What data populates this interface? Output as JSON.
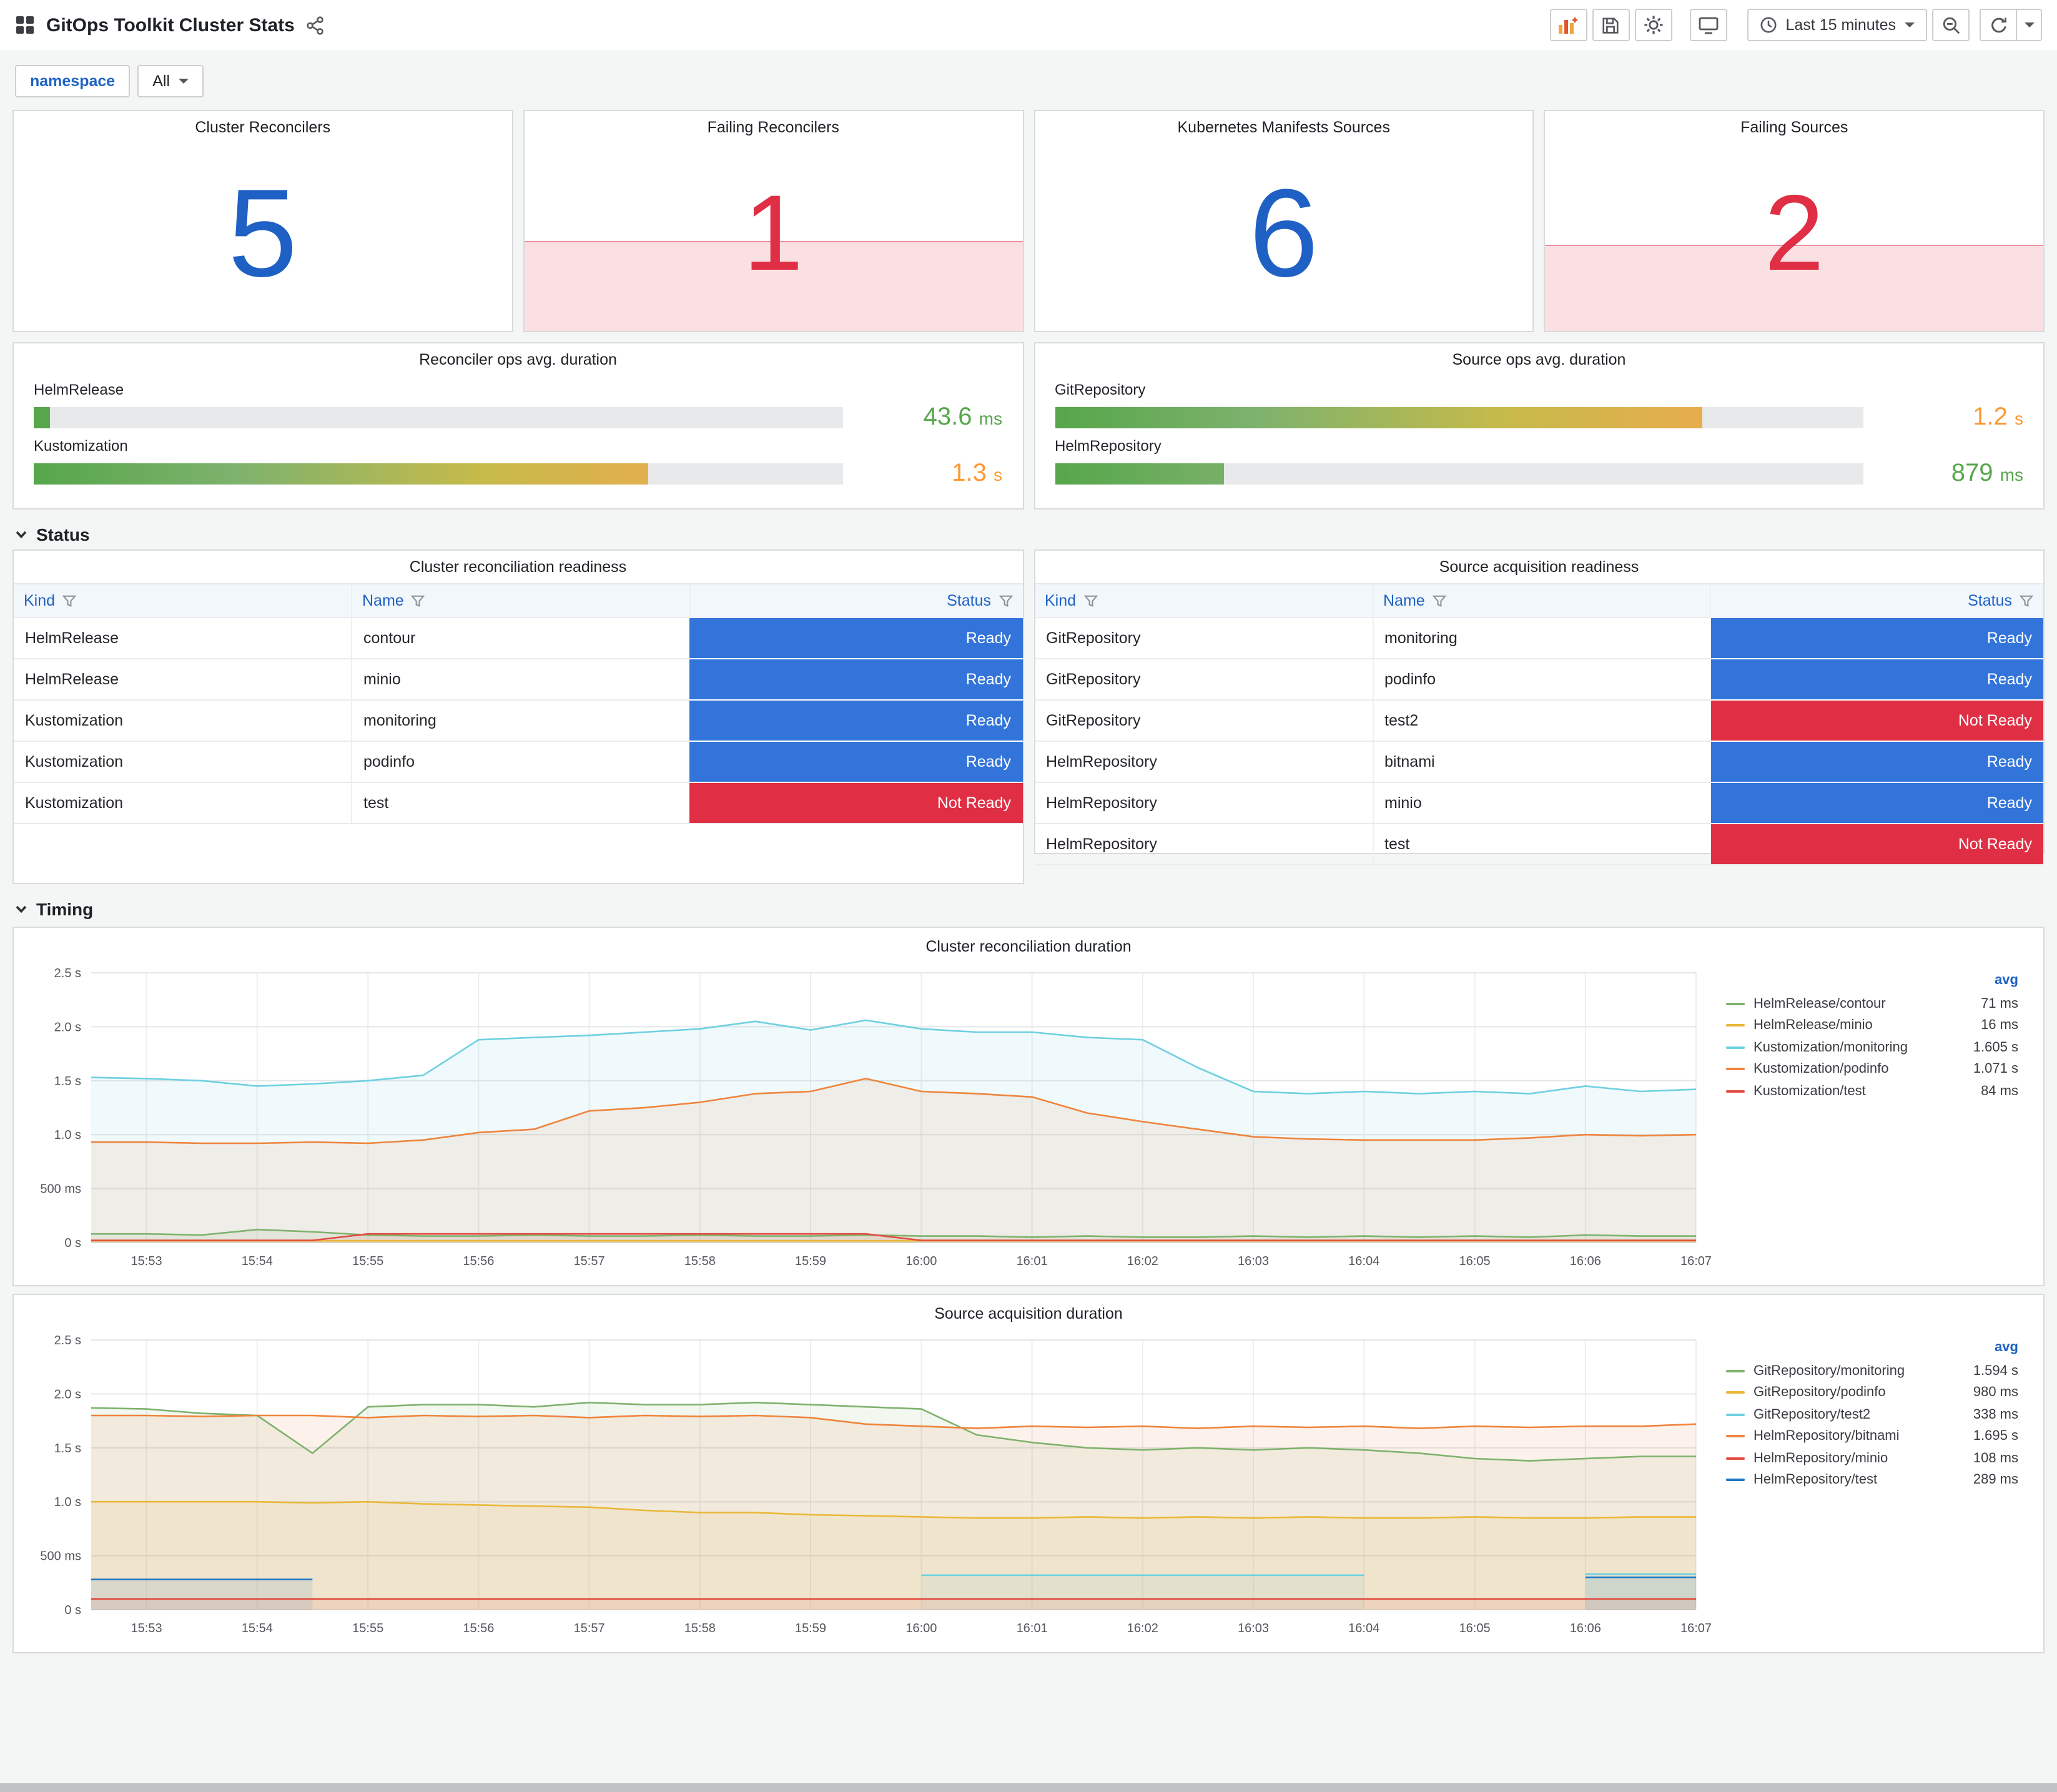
{
  "header": {
    "title": "GitOps Toolkit Cluster Stats",
    "time_picker": "Last 15 minutes"
  },
  "variables": {
    "namespace_label": "namespace",
    "namespace_value": "All"
  },
  "stats": [
    {
      "title": "Cluster Reconcilers",
      "value": "5",
      "state": "ok"
    },
    {
      "title": "Failing Reconcilers",
      "value": "1",
      "state": "alert"
    },
    {
      "title": "Kubernetes Manifests Sources",
      "value": "6",
      "state": "ok"
    },
    {
      "title": "Failing Sources",
      "value": "2",
      "state": "alert"
    }
  ],
  "colors": {
    "stat_ok": "#1f60c4",
    "stat_alert": "#e02f44",
    "ready_bg": "#3274d9",
    "not_ready_bg": "#e02f44"
  },
  "gauges": [
    {
      "title": "Reconciler ops avg. duration",
      "rows": [
        {
          "label": "HelmRelease",
          "value": "43.6",
          "unit": "ms",
          "pct": 2,
          "value_color": "#56a64b"
        },
        {
          "label": "Kustomization",
          "value": "1.3",
          "unit": "s",
          "pct": 76,
          "value_color": "#ff9830"
        }
      ]
    },
    {
      "title": "Source ops avg. duration",
      "rows": [
        {
          "label": "GitRepository",
          "value": "1.2",
          "unit": "s",
          "pct": 80,
          "value_color": "#ff9830"
        },
        {
          "label": "HelmRepository",
          "value": "879",
          "unit": "ms",
          "pct": 21,
          "value_color": "#56a64b"
        }
      ]
    }
  ],
  "sections": {
    "status": "Status",
    "timing": "Timing"
  },
  "tables": [
    {
      "title": "Cluster reconciliation readiness",
      "columns": [
        "Kind",
        "Name",
        "Status"
      ],
      "rows": [
        [
          "HelmRelease",
          "contour",
          "Ready"
        ],
        [
          "HelmRelease",
          "minio",
          "Ready"
        ],
        [
          "Kustomization",
          "monitoring",
          "Ready"
        ],
        [
          "Kustomization",
          "podinfo",
          "Ready"
        ],
        [
          "Kustomization",
          "test",
          "Not Ready"
        ]
      ]
    },
    {
      "title": "Source acquisition readiness",
      "columns": [
        "Kind",
        "Name",
        "Status"
      ],
      "rows": [
        [
          "GitRepository",
          "monitoring",
          "Ready"
        ],
        [
          "GitRepository",
          "podinfo",
          "Ready"
        ],
        [
          "GitRepository",
          "test2",
          "Not Ready"
        ],
        [
          "HelmRepository",
          "bitnami",
          "Ready"
        ],
        [
          "HelmRepository",
          "minio",
          "Ready"
        ],
        [
          "HelmRepository",
          "test",
          "Not Ready"
        ]
      ]
    }
  ],
  "chart_data": [
    {
      "type": "line",
      "title": "Cluster reconciliation duration",
      "legend_header": "avg",
      "ylim": [
        0,
        2.5
      ],
      "y_ticks": [
        {
          "v": 0,
          "label": "0 s"
        },
        {
          "v": 0.5,
          "label": "500 ms"
        },
        {
          "v": 1.0,
          "label": "1.0 s"
        },
        {
          "v": 1.5,
          "label": "1.5 s"
        },
        {
          "v": 2.0,
          "label": "2.0 s"
        },
        {
          "v": 2.5,
          "label": "2.5 s"
        }
      ],
      "x_ticks": [
        "15:53",
        "15:54",
        "15:55",
        "15:56",
        "15:57",
        "15:58",
        "15:59",
        "16:00",
        "16:01",
        "16:02",
        "16:03",
        "16:04",
        "16:05",
        "16:06",
        "16:07"
      ],
      "series": [
        {
          "name": "HelmRelease/contour",
          "avg": "71 ms",
          "color": "#7EB26D",
          "values": [
            0.08,
            0.08,
            0.07,
            0.12,
            0.1,
            0.07,
            0.06,
            0.06,
            0.07,
            0.06,
            0.06,
            0.07,
            0.06,
            0.06,
            0.07,
            0.06,
            0.06,
            0.05,
            0.06,
            0.05,
            0.05,
            0.06,
            0.05,
            0.06,
            0.05,
            0.06,
            0.05,
            0.07,
            0.06,
            0.06
          ]
        },
        {
          "name": "HelmRelease/minio",
          "avg": "16 ms",
          "color": "#EAB839",
          "values": [
            0.016,
            0.016,
            0.016,
            0.016,
            0.016,
            0.016,
            0.016,
            0.016,
            0.016,
            0.016,
            0.016,
            0.016,
            0.016,
            0.016,
            0.016,
            0.016,
            0.016,
            0.016,
            0.016,
            0.016,
            0.016,
            0.016,
            0.016,
            0.016,
            0.016,
            0.016,
            0.016,
            0.016,
            0.016,
            0.016
          ]
        },
        {
          "name": "Kustomization/monitoring",
          "avg": "1.605 s",
          "color": "#6ED0E0",
          "values": [
            1.53,
            1.52,
            1.5,
            1.45,
            1.47,
            1.5,
            1.55,
            1.88,
            1.9,
            1.92,
            1.95,
            1.98,
            2.05,
            1.97,
            2.06,
            1.98,
            1.95,
            1.95,
            1.9,
            1.88,
            1.62,
            1.4,
            1.38,
            1.4,
            1.38,
            1.4,
            1.38,
            1.45,
            1.4,
            1.42
          ]
        },
        {
          "name": "Kustomization/podinfo",
          "avg": "1.071 s",
          "color": "#EF843C",
          "values": [
            0.93,
            0.93,
            0.92,
            0.92,
            0.93,
            0.92,
            0.95,
            1.02,
            1.05,
            1.22,
            1.25,
            1.3,
            1.38,
            1.4,
            1.52,
            1.4,
            1.38,
            1.35,
            1.2,
            1.12,
            1.05,
            0.98,
            0.96,
            0.95,
            0.95,
            0.95,
            0.97,
            1.0,
            0.99,
            1.0
          ]
        },
        {
          "name": "Kustomization/test",
          "avg": "84 ms",
          "color": "#E24D42",
          "values": [
            0.02,
            0.02,
            0.02,
            0.02,
            0.02,
            0.08,
            0.08,
            0.08,
            0.08,
            0.08,
            0.08,
            0.08,
            0.08,
            0.08,
            0.08,
            0.02,
            0.02,
            0.02,
            0.02,
            0.02,
            0.02,
            0.02,
            0.02,
            0.02,
            0.02,
            0.02,
            0.02,
            0.02,
            0.02,
            0.02
          ]
        }
      ]
    },
    {
      "type": "line",
      "title": "Source acquisition duration",
      "legend_header": "avg",
      "ylim": [
        0,
        2.5
      ],
      "y_ticks": [
        {
          "v": 0,
          "label": "0 s"
        },
        {
          "v": 0.5,
          "label": "500 ms"
        },
        {
          "v": 1.0,
          "label": "1.0 s"
        },
        {
          "v": 1.5,
          "label": "1.5 s"
        },
        {
          "v": 2.0,
          "label": "2.0 s"
        },
        {
          "v": 2.5,
          "label": "2.5 s"
        }
      ],
      "x_ticks": [
        "15:53",
        "15:54",
        "15:55",
        "15:56",
        "15:57",
        "15:58",
        "15:59",
        "16:00",
        "16:01",
        "16:02",
        "16:03",
        "16:04",
        "16:05",
        "16:06",
        "16:07"
      ],
      "series": [
        {
          "name": "GitRepository/monitoring",
          "avg": "1.594 s",
          "color": "#7EB26D",
          "values": [
            1.87,
            1.86,
            1.82,
            1.8,
            1.45,
            1.88,
            1.9,
            1.9,
            1.88,
            1.92,
            1.9,
            1.9,
            1.92,
            1.9,
            1.88,
            1.86,
            1.62,
            1.55,
            1.5,
            1.48,
            1.5,
            1.48,
            1.5,
            1.48,
            1.45,
            1.4,
            1.38,
            1.4,
            1.42,
            1.42
          ]
        },
        {
          "name": "GitRepository/podinfo",
          "avg": "980 ms",
          "color": "#EAB839",
          "values": [
            1.0,
            1.0,
            1.0,
            1.0,
            0.99,
            1.0,
            0.98,
            0.97,
            0.96,
            0.95,
            0.92,
            0.9,
            0.9,
            0.88,
            0.87,
            0.86,
            0.85,
            0.85,
            0.86,
            0.85,
            0.86,
            0.85,
            0.86,
            0.85,
            0.85,
            0.86,
            0.85,
            0.85,
            0.86,
            0.86
          ]
        },
        {
          "name": "GitRepository/test2",
          "avg": "338 ms",
          "color": "#6ED0E0",
          "values": [
            null,
            null,
            null,
            null,
            null,
            null,
            null,
            null,
            null,
            null,
            null,
            null,
            null,
            null,
            null,
            0.32,
            0.32,
            0.32,
            0.32,
            0.32,
            0.32,
            0.32,
            0.32,
            0.32,
            null,
            null,
            null,
            0.33,
            0.33,
            0.33
          ]
        },
        {
          "name": "HelmRepository/bitnami",
          "avg": "1.695 s",
          "color": "#EF843C",
          "values": [
            1.8,
            1.8,
            1.79,
            1.8,
            1.8,
            1.78,
            1.8,
            1.79,
            1.8,
            1.78,
            1.8,
            1.79,
            1.8,
            1.78,
            1.72,
            1.7,
            1.68,
            1.7,
            1.69,
            1.7,
            1.68,
            1.7,
            1.69,
            1.7,
            1.68,
            1.7,
            1.69,
            1.7,
            1.7,
            1.72
          ]
        },
        {
          "name": "HelmRepository/minio",
          "avg": "108 ms",
          "color": "#E24D42",
          "values": [
            0.1,
            0.1,
            0.1,
            0.1,
            0.1,
            0.1,
            0.1,
            0.1,
            0.1,
            0.1,
            0.1,
            0.1,
            0.1,
            0.1,
            0.1,
            0.1,
            0.1,
            0.1,
            0.1,
            0.1,
            0.1,
            0.1,
            0.1,
            0.1,
            0.1,
            0.1,
            0.1,
            0.1,
            0.1,
            0.1
          ]
        },
        {
          "name": "HelmRepository/test",
          "avg": "289 ms",
          "color": "#1F78C1",
          "values": [
            0.28,
            0.28,
            0.28,
            0.28,
            0.28,
            null,
            null,
            null,
            null,
            null,
            null,
            null,
            null,
            null,
            null,
            null,
            null,
            null,
            null,
            null,
            null,
            null,
            null,
            null,
            null,
            null,
            null,
            0.3,
            0.3,
            0.3
          ]
        }
      ]
    }
  ]
}
